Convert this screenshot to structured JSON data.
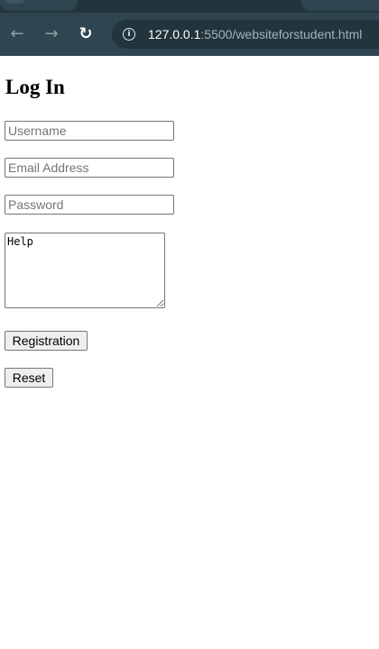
{
  "browser": {
    "url_host": "127.0.0.1",
    "url_rest": ":5500/websiteforstudent.html",
    "icons": {
      "back": "arrow-left-icon",
      "forward": "arrow-right-icon",
      "reload": "reload-icon",
      "site_info": "info-icon"
    }
  },
  "page": {
    "title": "Log In",
    "username_placeholder": "Username",
    "email_placeholder": "Email Address",
    "password_placeholder": "Password",
    "help_value": "Help",
    "registration_label": "Registration",
    "reset_label": "Reset"
  }
}
